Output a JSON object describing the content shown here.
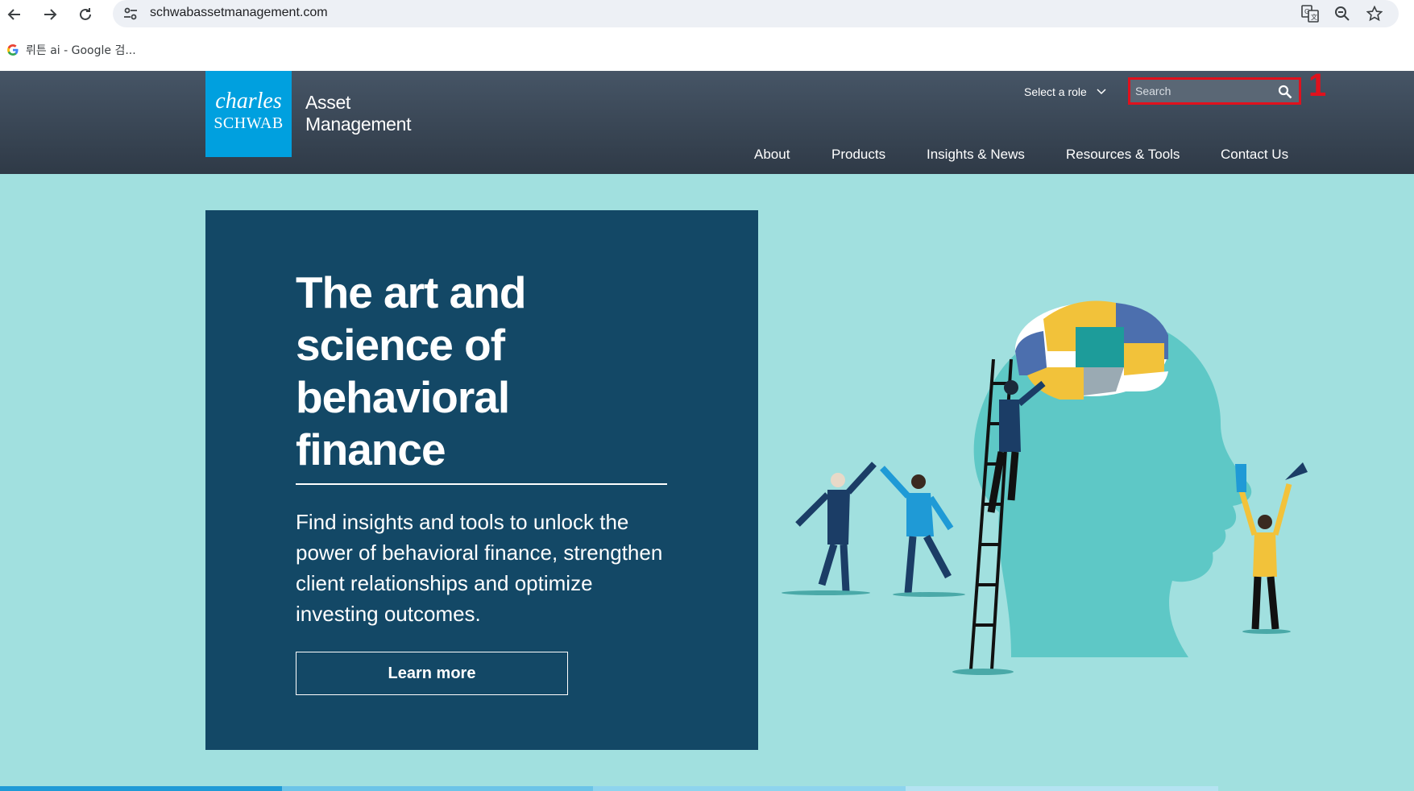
{
  "browser": {
    "url": "schwabassetmanagement.com",
    "bookmark_label": "뤼튼 ai - Google 검..."
  },
  "header": {
    "logo_line1": "charles",
    "logo_line2": "SCHWAB",
    "brand_line1": "Asset",
    "brand_line2": "Management",
    "role_select": "Select a role",
    "search_placeholder": "Search",
    "annotation": "1",
    "nav": [
      "About",
      "Products",
      "Insights & News",
      "Resources & Tools",
      "Contact Us"
    ]
  },
  "hero": {
    "title": "The art and science of behavioral finance",
    "body": "Find insights and tools to unlock the power of behavioral finance, strengthen client relationships and optimize investing outcomes.",
    "cta": "Learn more"
  },
  "colors": {
    "header_bg": "#3a4654",
    "logo_bg": "#00a0df",
    "hero_bg": "#a1e0df",
    "card_bg": "#134866",
    "annotation_red": "#e0111d"
  }
}
